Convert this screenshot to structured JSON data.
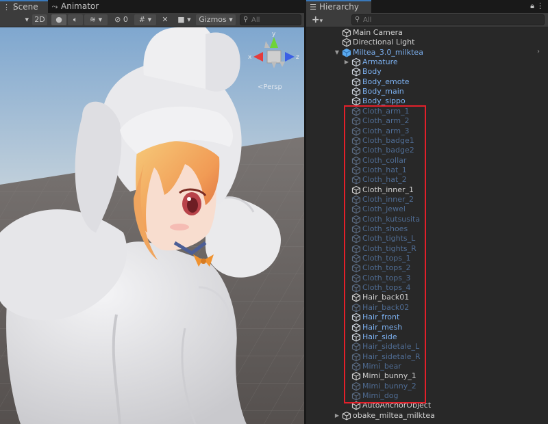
{
  "scene_tabs": [
    {
      "label": "Scene",
      "icon": "grid-icon"
    },
    {
      "label": "Animator",
      "icon": "animator-icon"
    }
  ],
  "scene_toolbar": {
    "mode_2d": "2D",
    "hidden_count": "0",
    "gizmos_label": "Gizmos",
    "search_placeholder": "All"
  },
  "scene_gizmo": {
    "axes": {
      "x": "x",
      "y": "y",
      "z": "z"
    },
    "projection": "Persp"
  },
  "hierarchy": {
    "tab_label": "Hierarchy",
    "add_label": "+",
    "search_placeholder": "All",
    "rows": [
      {
        "label": "Main Camera",
        "style": "white",
        "depth": 1,
        "arrow": ""
      },
      {
        "label": "Directional Light",
        "style": "white",
        "depth": 1,
        "arrow": ""
      },
      {
        "label": "Miltea_3.0_milktea",
        "style": "blue",
        "depth": 1,
        "arrow": "down",
        "prefab_root": true
      },
      {
        "label": "Armature",
        "style": "blue",
        "depth": 2,
        "arrow": "right"
      },
      {
        "label": "Body",
        "style": "blue",
        "depth": 2,
        "arrow": ""
      },
      {
        "label": "Body_emote",
        "style": "blue",
        "depth": 2,
        "arrow": ""
      },
      {
        "label": "Body_main",
        "style": "blue",
        "depth": 2,
        "arrow": ""
      },
      {
        "label": "Body_sippo",
        "style": "blue",
        "depth": 2,
        "arrow": ""
      },
      {
        "label": "Cloth_arm_1",
        "style": "dim",
        "depth": 2,
        "arrow": ""
      },
      {
        "label": "Cloth_arm_2",
        "style": "dim",
        "depth": 2,
        "arrow": ""
      },
      {
        "label": "Cloth_arm_3",
        "style": "dim",
        "depth": 2,
        "arrow": ""
      },
      {
        "label": "Cloth_badge1",
        "style": "dim",
        "depth": 2,
        "arrow": ""
      },
      {
        "label": "Cloth_badge2",
        "style": "dim",
        "depth": 2,
        "arrow": ""
      },
      {
        "label": "Cloth_collar",
        "style": "dim",
        "depth": 2,
        "arrow": ""
      },
      {
        "label": "Cloth_hat_1",
        "style": "dim",
        "depth": 2,
        "arrow": ""
      },
      {
        "label": "Cloth_hat_2",
        "style": "dim",
        "depth": 2,
        "arrow": ""
      },
      {
        "label": "Cloth_inner_1",
        "style": "white",
        "depth": 2,
        "arrow": ""
      },
      {
        "label": "Cloth_inner_2",
        "style": "dim",
        "depth": 2,
        "arrow": ""
      },
      {
        "label": "Cloth_jewel",
        "style": "dim",
        "depth": 2,
        "arrow": ""
      },
      {
        "label": "Cloth_kutsusita",
        "style": "dim",
        "depth": 2,
        "arrow": ""
      },
      {
        "label": "Cloth_shoes",
        "style": "dim",
        "depth": 2,
        "arrow": ""
      },
      {
        "label": "Cloth_tights_L",
        "style": "dim",
        "depth": 2,
        "arrow": ""
      },
      {
        "label": "Cloth_tights_R",
        "style": "dim",
        "depth": 2,
        "arrow": ""
      },
      {
        "label": "Cloth_tops_1",
        "style": "dim",
        "depth": 2,
        "arrow": ""
      },
      {
        "label": "Cloth_tops_2",
        "style": "dim",
        "depth": 2,
        "arrow": ""
      },
      {
        "label": "Cloth_tops_3",
        "style": "dim",
        "depth": 2,
        "arrow": ""
      },
      {
        "label": "Cloth_tops_4",
        "style": "dim",
        "depth": 2,
        "arrow": ""
      },
      {
        "label": "Hair_back01",
        "style": "white",
        "depth": 2,
        "arrow": ""
      },
      {
        "label": "Hair_back02",
        "style": "dim",
        "depth": 2,
        "arrow": ""
      },
      {
        "label": "Hair_front",
        "style": "blue",
        "depth": 2,
        "arrow": ""
      },
      {
        "label": "Hair_mesh",
        "style": "blue",
        "depth": 2,
        "arrow": ""
      },
      {
        "label": "Hair_side",
        "style": "blue",
        "depth": 2,
        "arrow": ""
      },
      {
        "label": "Hair_sidetale_L",
        "style": "dim",
        "depth": 2,
        "arrow": ""
      },
      {
        "label": "Hair_sidetale_R",
        "style": "dim",
        "depth": 2,
        "arrow": ""
      },
      {
        "label": "Mimi_bear",
        "style": "dim",
        "depth": 2,
        "arrow": ""
      },
      {
        "label": "Mimi_bunny_1",
        "style": "white",
        "depth": 2,
        "arrow": ""
      },
      {
        "label": "Mimi_bunny_2",
        "style": "dim",
        "depth": 2,
        "arrow": ""
      },
      {
        "label": "Mimi_dog",
        "style": "dim",
        "depth": 2,
        "arrow": ""
      },
      {
        "label": "AutoAnchorObject",
        "style": "white",
        "depth": 2,
        "arrow": ""
      },
      {
        "label": "obake_miltea_milktea",
        "style": "white",
        "depth": 1,
        "arrow": "right"
      }
    ]
  },
  "colors": {
    "highlight_box": "#e3202a",
    "prefab_blue": "#7cb0ef",
    "inactive": "#4f6c93",
    "panel": "#282828",
    "sky": "#8fb6dc",
    "ground": "#6e6a68"
  }
}
